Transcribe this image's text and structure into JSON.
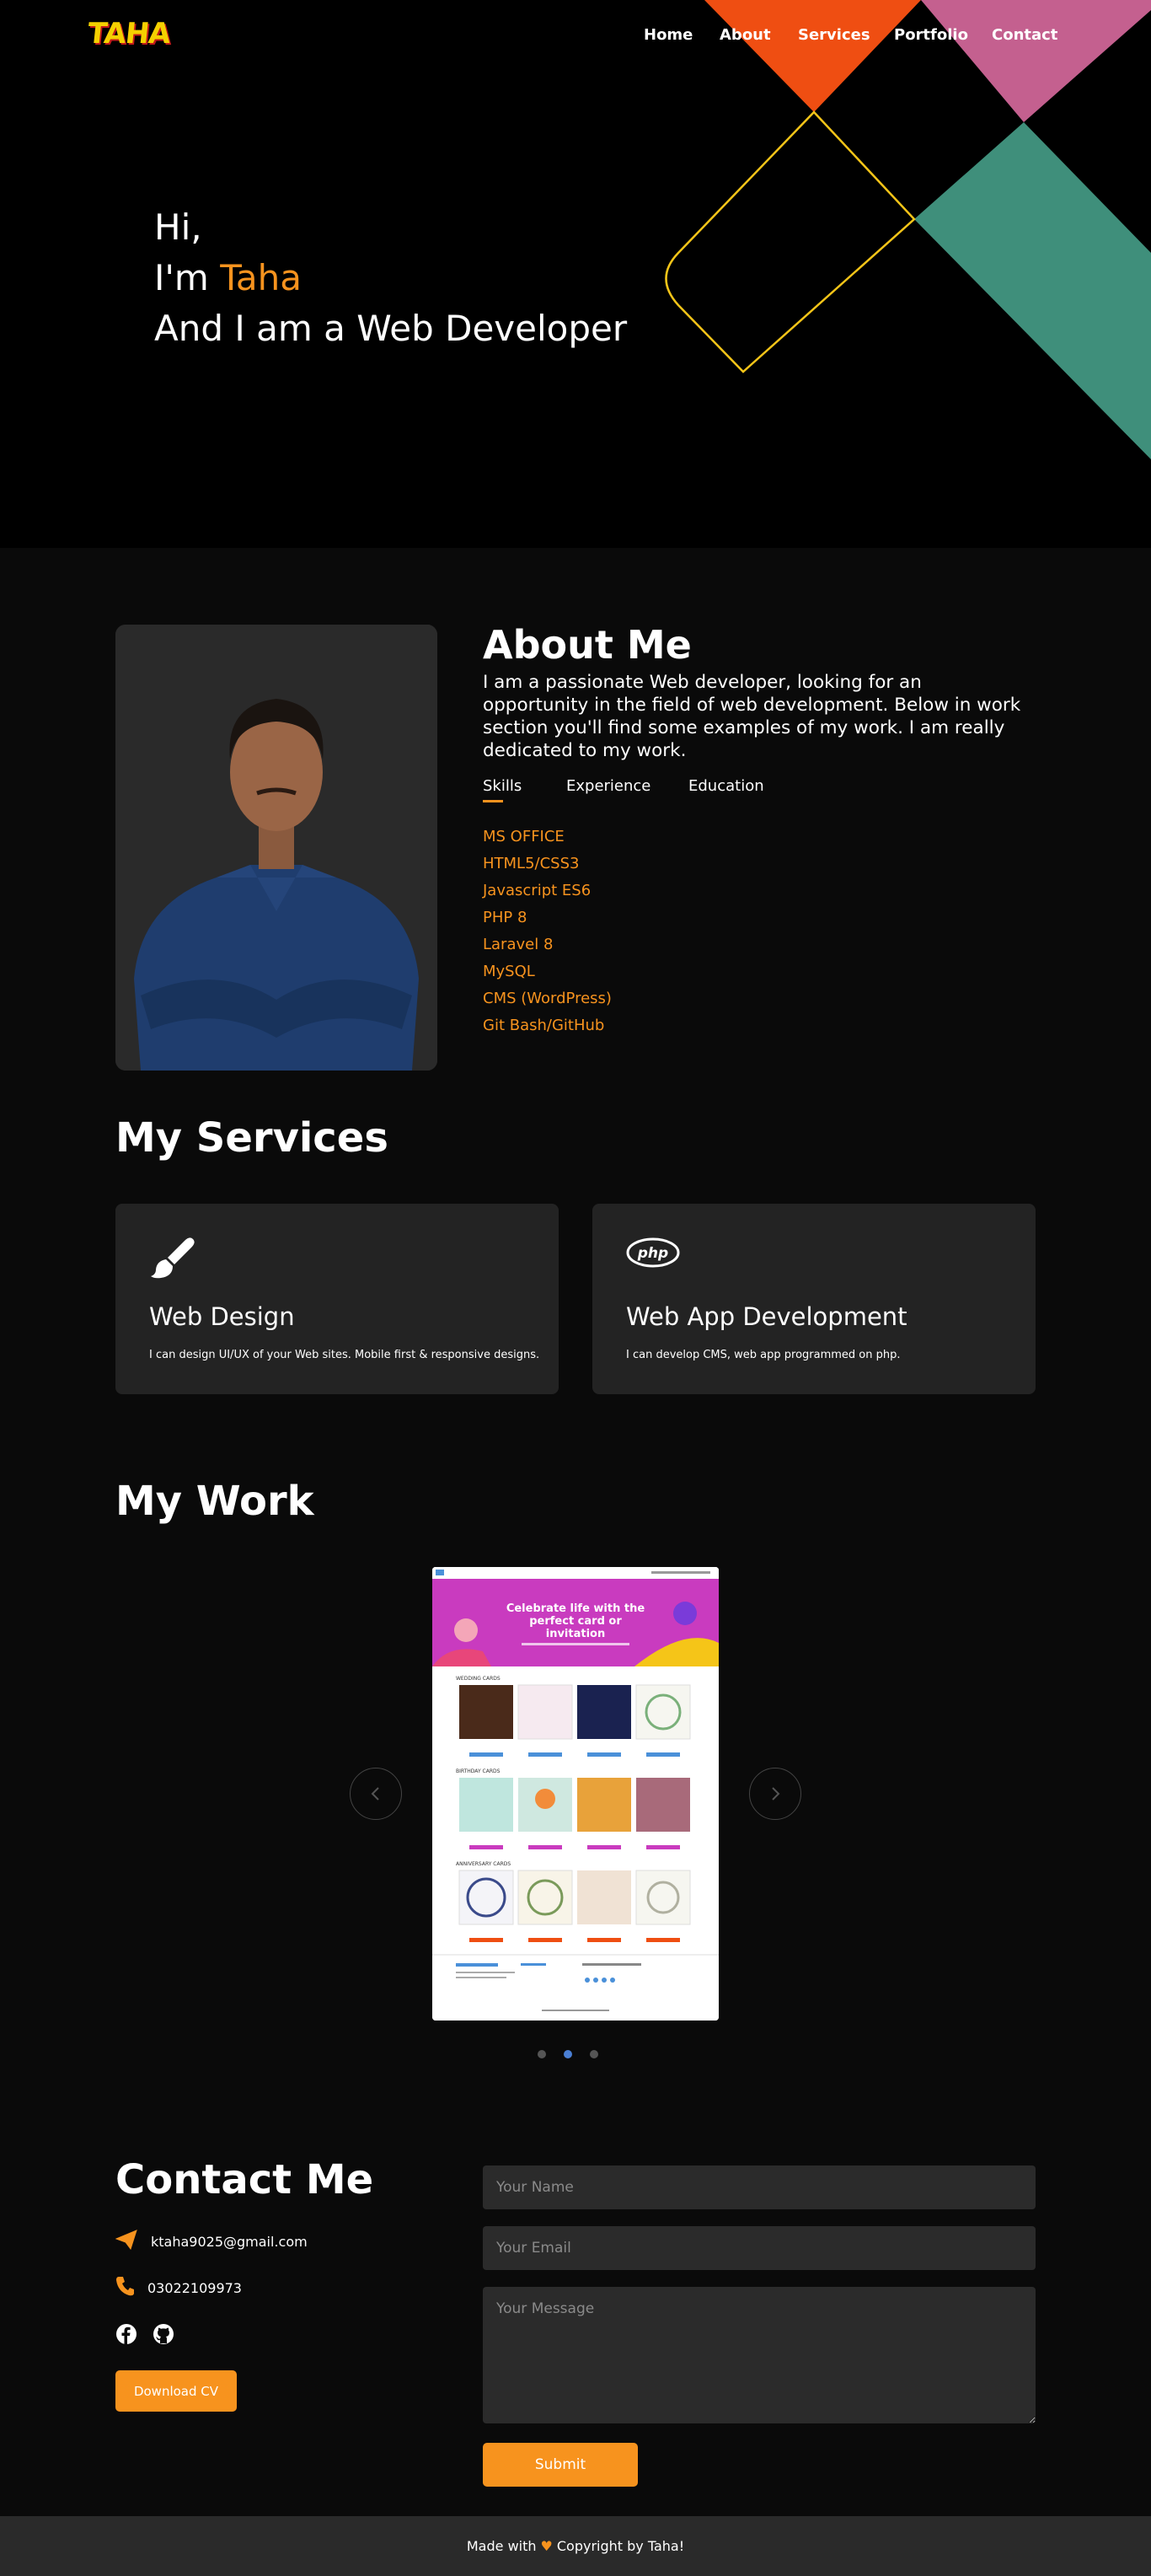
{
  "nav": {
    "logo": "TAHA",
    "items": [
      "Home",
      "About",
      "Services",
      "Portfolio",
      "Contact"
    ]
  },
  "hero": {
    "line1": "Hi,",
    "line2_prefix": "I'm ",
    "name": "Taha",
    "line3": "And I am a Web Developer"
  },
  "about": {
    "title": "About Me",
    "description": "I am a passionate Web developer, looking for an opportunity in the field of web development. Below in work section you'll find some examples of my work. I am really dedicated to my work.",
    "tabs": [
      "Skills",
      "Experience",
      "Education"
    ],
    "skills": [
      "MS OFFICE",
      "HTML5/CSS3",
      "Javascript ES6",
      "PHP 8",
      "Laravel 8",
      "MySQL",
      "CMS (WordPress)",
      "Git Bash/GitHub"
    ]
  },
  "services": {
    "title": "My Services",
    "items": [
      {
        "icon": "paintbrush-icon",
        "title": "Web Design",
        "desc": "I can design UI/UX of your Web sites. Mobile first & responsive designs."
      },
      {
        "icon": "php-icon",
        "title": "Web App Development",
        "desc": "I can develop CMS, web app programmed on php."
      }
    ]
  },
  "work": {
    "title": "My Work",
    "slide": {
      "hero_text": "Celebrate life with the perfect card or invitation",
      "sections": [
        "WEDDING CARDS",
        "BIRTHDAY CARDS",
        "ANNIVERSARY CARDS"
      ]
    },
    "dots": 3,
    "active_dot": 1
  },
  "contact": {
    "title": "Contact Me",
    "email": "ktaha9025@gmail.com",
    "phone": "03022109973",
    "cv_label": "Download CV",
    "name_placeholder": "Your Name",
    "email_placeholder": "Your Email",
    "message_placeholder": "Your Message",
    "submit_label": "Submit"
  },
  "footer": {
    "prefix": "Made with",
    "suffix": "Copyright by Taha!"
  },
  "colors": {
    "accent": "#f7931e",
    "orange_shape": "#ef4e12",
    "pink_shape": "#c4608f",
    "teal_shape": "#3f8f7b",
    "outline_shape": "#f5c518"
  }
}
